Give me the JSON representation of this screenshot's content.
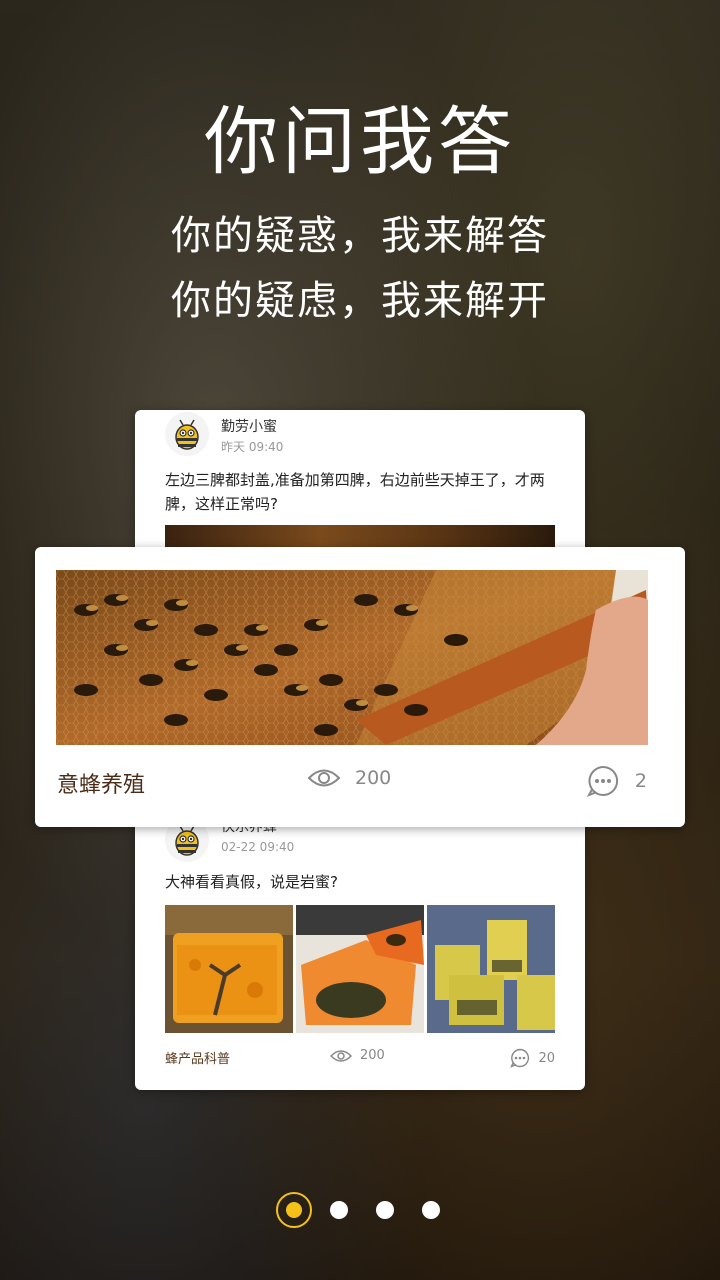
{
  "header": {
    "title": "你问我答",
    "subtitle_line1": "你的疑惑，我来解答",
    "subtitle_line2": "你的疑虑，我来解开"
  },
  "back_card": {
    "post1": {
      "username": "勤劳小蜜",
      "time": "昨天 09:40",
      "text": "左边三脾都封盖,准备加第四脾，右边前些天掉王了，才两脾，这样正常吗?"
    },
    "post2": {
      "username": "快乐养蜂",
      "time": "02-22 09:40",
      "text": "大神看看真假，说是岩蜜?",
      "category": "蜂产品科普",
      "views": "200",
      "comments": "20"
    }
  },
  "front_card": {
    "category": "意蜂养殖",
    "views": "200",
    "comments": "2"
  },
  "pager": {
    "active_index": 0,
    "count": 4
  },
  "colors": {
    "accent": "#f5c118",
    "category_text": "#4a2c18"
  },
  "icons": [
    "bee-avatar-icon",
    "eye-icon",
    "comment-icon"
  ]
}
